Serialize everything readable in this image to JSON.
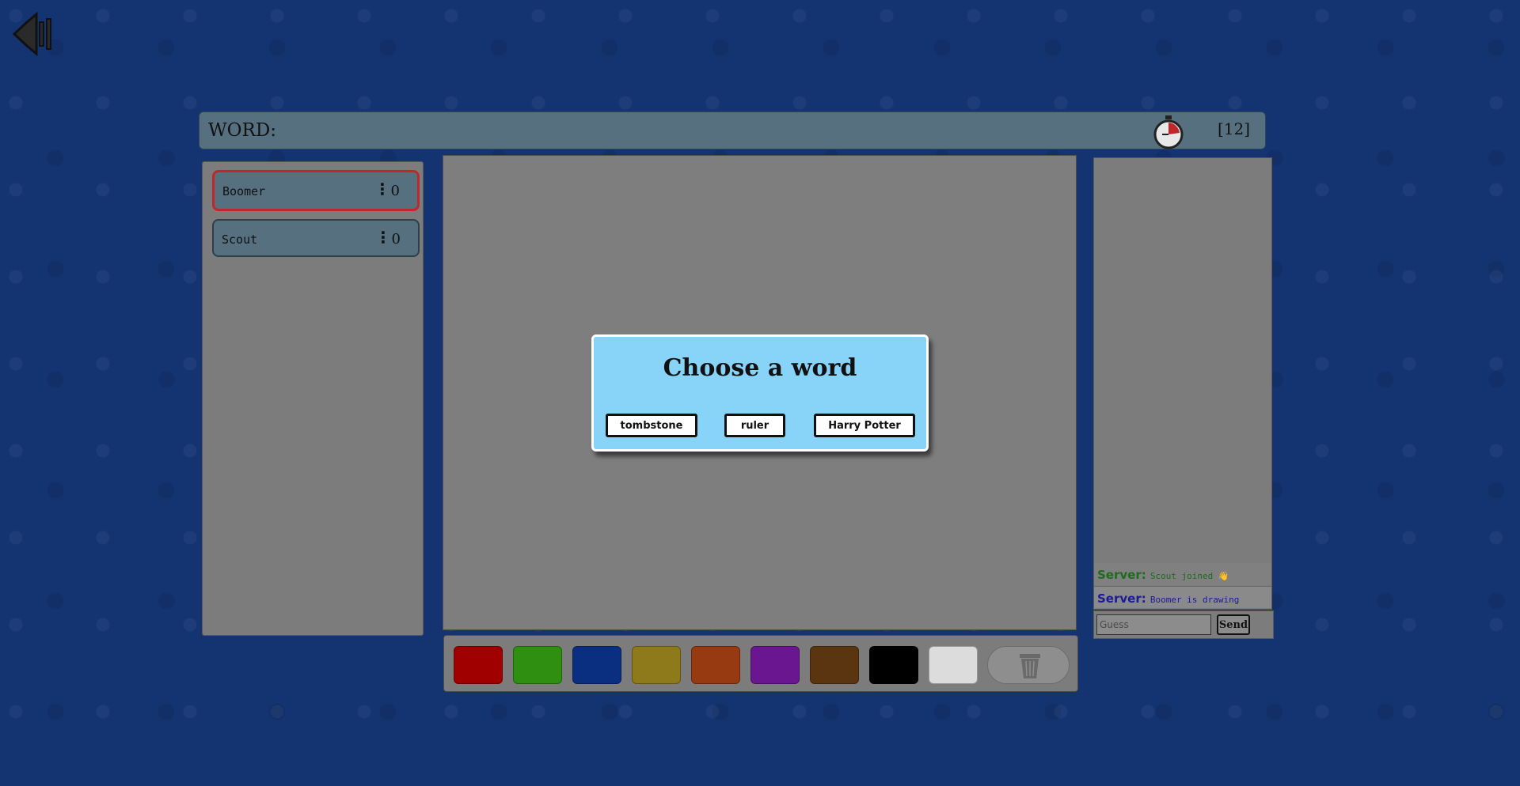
{
  "header": {
    "word_label": "WORD:",
    "timer": "[12]"
  },
  "players": [
    {
      "name": "Boomer",
      "menu": "⋮",
      "score": "0",
      "active": true
    },
    {
      "name": "Scout",
      "menu": "⋮",
      "score": "0",
      "active": false
    }
  ],
  "modal": {
    "title": "Choose a word",
    "options": [
      "tombstone",
      "ruler",
      "Harry Potter"
    ]
  },
  "chat": {
    "messages": [
      {
        "sender": "Server:",
        "text": "Scout joined 👋"
      },
      {
        "sender": "Server:",
        "text": "Boomer is drawing"
      }
    ],
    "guess_placeholder": "Guess",
    "send_label": "Send"
  },
  "palette": {
    "colors": [
      "#a00000",
      "#2e8f10",
      "#0a2e80",
      "#8e7a1a",
      "#973a12",
      "#6a1690",
      "#5a3510",
      "#000000",
      "#dcdcdc"
    ]
  },
  "icons": {
    "sound": "speaker-icon",
    "timer": "stopwatch-icon",
    "trash": "trash-icon"
  }
}
